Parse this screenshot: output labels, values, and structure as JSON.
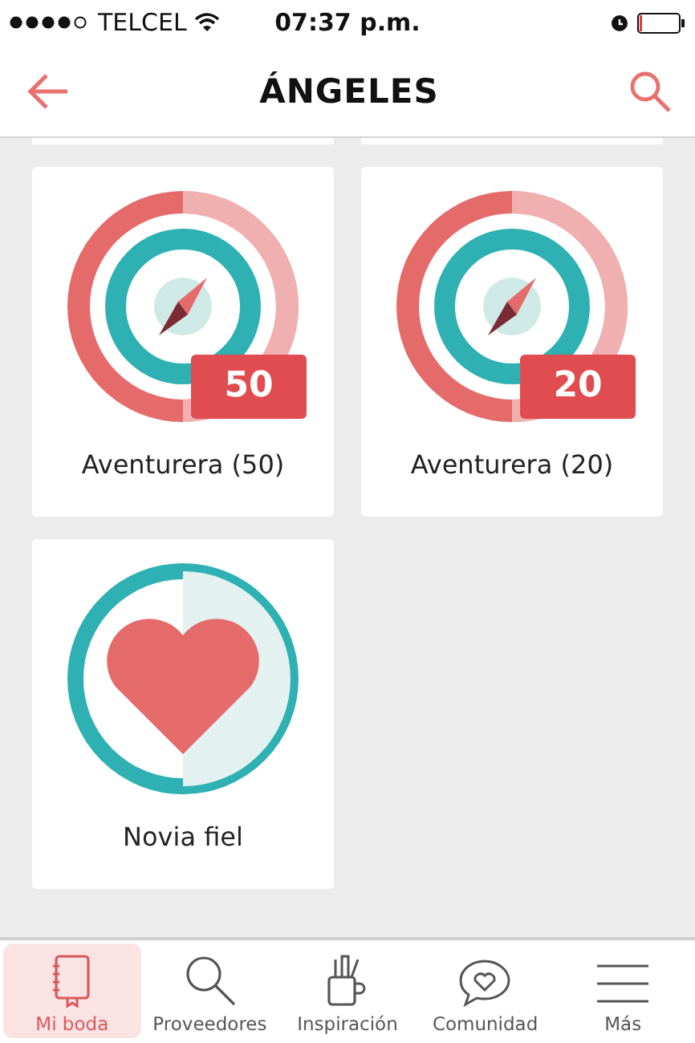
{
  "status_bar": {
    "carrier": "TELCEL",
    "time": "07:37 p.m."
  },
  "header": {
    "title": "ÁNGELES"
  },
  "badges": [
    {
      "kind": "compass",
      "count": "50",
      "label": "Aventurera (50)"
    },
    {
      "kind": "compass",
      "count": "20",
      "label": "Aventurera (20)"
    },
    {
      "kind": "heart",
      "label": "Novia fiel"
    }
  ],
  "tab_bar": [
    {
      "kind": "notebook",
      "label": "Mi boda",
      "selected": true
    },
    {
      "kind": "search",
      "label": "Proveedores",
      "selected": false
    },
    {
      "kind": "mug",
      "label": "Inspiración",
      "selected": false
    },
    {
      "kind": "chat",
      "label": "Comunidad",
      "selected": false
    },
    {
      "kind": "menu",
      "label": "Más",
      "selected": false
    }
  ]
}
